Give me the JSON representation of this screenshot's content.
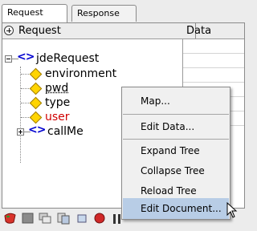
{
  "tabs": [
    "Request",
    "Response"
  ],
  "active_tab": "Request",
  "table": {
    "col_request": "Request",
    "col_data": "Data"
  },
  "tree": {
    "root": "jdeRequest",
    "nodes": [
      {
        "label": "environment",
        "color": "#000000"
      },
      {
        "label": "pwd",
        "color": "#000000"
      },
      {
        "label": "type",
        "color": "#000000"
      },
      {
        "label": "user",
        "color": "#d00000"
      },
      {
        "label": "callMe",
        "color": "#000000"
      }
    ]
  },
  "context_menu": {
    "items": [
      "Map...",
      "Edit Data...",
      "Expand Tree",
      "Collapse Tree",
      "Reload Tree",
      "Edit Document..."
    ],
    "highlighted": "Edit Document..."
  },
  "toolbar_icons": [
    "red-shape-icon",
    "gray-square-icon",
    "stack-icon",
    "stack2-icon",
    "small-icon",
    "red-ball-icon",
    "bars-icon"
  ]
}
